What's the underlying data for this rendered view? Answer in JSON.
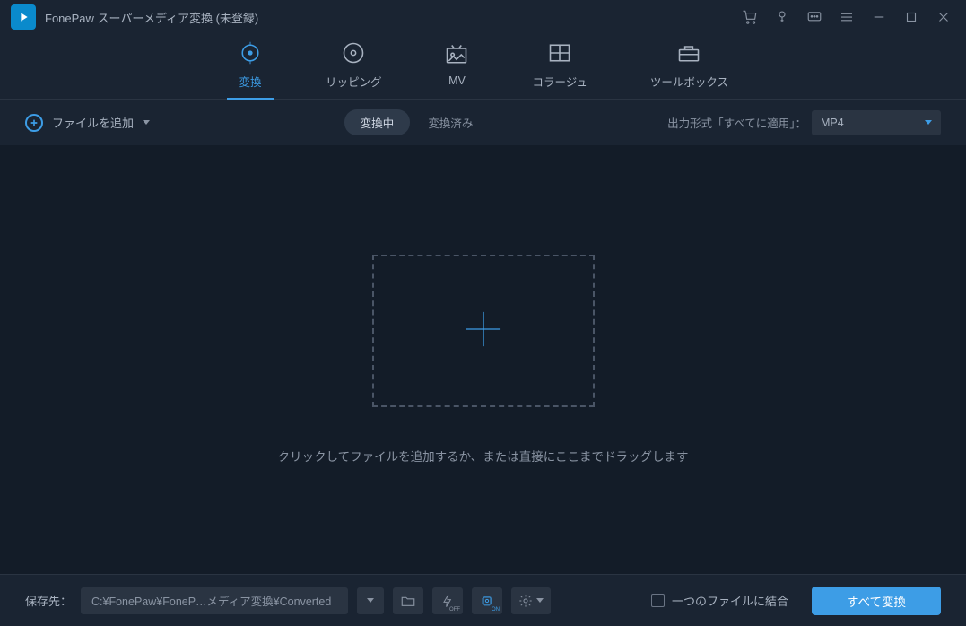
{
  "app": {
    "title": "FonePaw スーパーメディア変換 (未登録)"
  },
  "nav": {
    "convert": "変換",
    "ripping": "リッピング",
    "mv": "MV",
    "collage": "コラージュ",
    "toolbox": "ツールボックス"
  },
  "toolbar": {
    "add_file": "ファイルを追加",
    "converting": "変換中",
    "converted": "変換済み",
    "output_label": "出力形式「すべてに適用」：",
    "format": "MP4"
  },
  "main": {
    "hint": "クリックしてファイルを追加するか、または直接にここまでドラッグします"
  },
  "footer": {
    "save_label": "保存先：",
    "path": "C:¥FonePaw¥FoneP…メディア変換¥Converted",
    "accel_off": "OFF",
    "accel_on": "ON",
    "merge_label": "一つのファイルに結合",
    "convert_all": "すべて変換"
  }
}
